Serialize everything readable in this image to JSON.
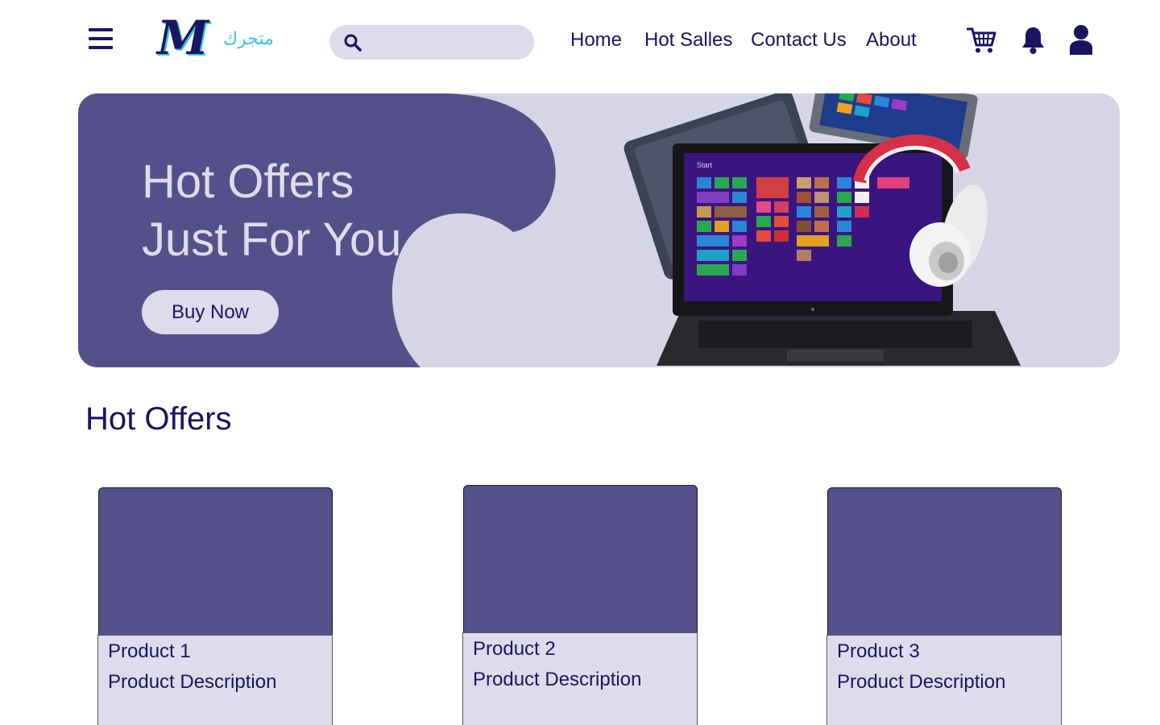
{
  "header": {
    "logo_letter": "M",
    "logo_script": "متجرك",
    "search": {
      "placeholder": "",
      "value": ""
    },
    "nav": [
      "Home",
      "Hot Salles",
      "Contact Us",
      "About"
    ],
    "icons": [
      "menu-icon",
      "search-icon",
      "cart-icon",
      "bell-icon",
      "user-icon"
    ]
  },
  "hero": {
    "title_line1": "Hot Offers",
    "title_line2": "Just For You",
    "button_label": "Buy Now"
  },
  "section": {
    "title": "Hot Offers"
  },
  "products": [
    {
      "name": "Product 1",
      "description": "Product Description"
    },
    {
      "name": "Product 2",
      "description": "Product Description"
    },
    {
      "name": "Product 3",
      "description": "Product Description"
    }
  ],
  "colors": {
    "primary": "#1a1560",
    "banner_purple": "#56508a",
    "banner_light": "#d6d5e6",
    "search_bg": "#dedcec",
    "logo_accent": "#38c8dc"
  }
}
